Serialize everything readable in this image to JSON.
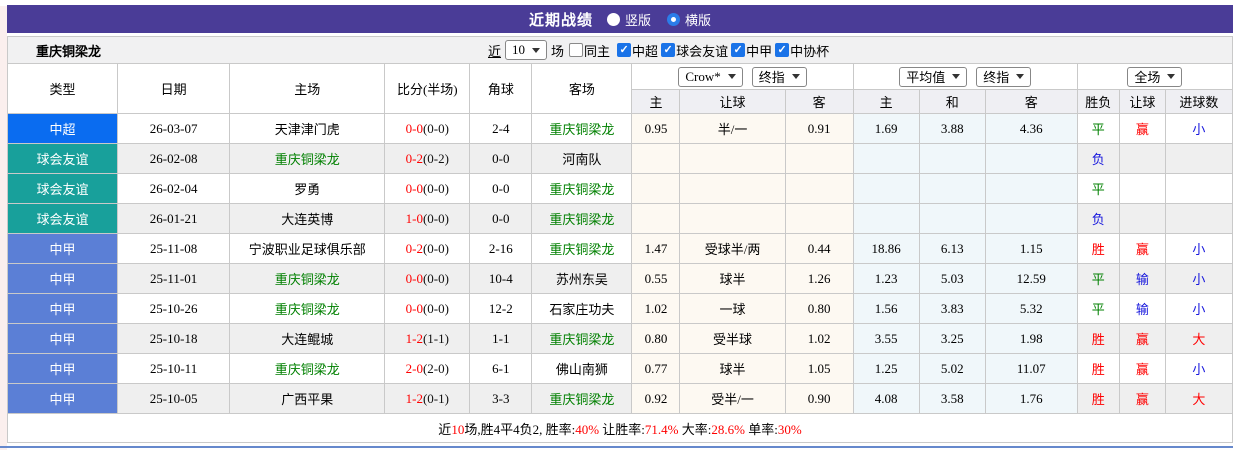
{
  "header": {
    "title": "近期战绩",
    "view_options": [
      {
        "label": "竖版",
        "selected": false
      },
      {
        "label": "横版",
        "selected": true
      }
    ]
  },
  "toolbar": {
    "team_name": "重庆铜梁龙",
    "recent_label": "近",
    "recent_count": "10",
    "matches_label": "场",
    "same_home": {
      "label": "同主",
      "checked": false
    },
    "league_filters": [
      {
        "label": "中超",
        "checked": true
      },
      {
        "label": "球会友谊",
        "checked": true
      },
      {
        "label": "中甲",
        "checked": true
      },
      {
        "label": "中协杯",
        "checked": true
      }
    ]
  },
  "table": {
    "columns_left": [
      "类型",
      "日期",
      "主场",
      "比分(半场)",
      "角球",
      "客场"
    ],
    "odds_group1_dropdowns": [
      "Crow*",
      "终指"
    ],
    "odds_group2_dropdowns": [
      "平均值",
      "终指"
    ],
    "odds_group3_dropdown": "全场",
    "columns_odds": [
      "主",
      "让球",
      "客",
      "主",
      "和",
      "客",
      "胜负",
      "让球",
      "进球数"
    ],
    "type_colors": {
      "中超": "#0a6cf0",
      "球会友谊": "#18a09b",
      "中甲": "#5b7fd6"
    },
    "rows": [
      {
        "type": "中超",
        "date": "26-03-07",
        "home": {
          "name": "天津津门虎",
          "highlight": false
        },
        "score_ft": "0-0",
        "score_ht": "(0-0)",
        "corner": "2-4",
        "away": {
          "name": "重庆铜梁龙",
          "highlight": true
        },
        "crow": [
          "0.95",
          "半/一",
          "0.91"
        ],
        "avg": [
          "1.69",
          "3.88",
          "4.36"
        ],
        "results": [
          {
            "text": "平",
            "color": "green"
          },
          {
            "text": "赢",
            "color": "red"
          },
          {
            "text": "小",
            "color": "blue"
          }
        ]
      },
      {
        "type": "球会友谊",
        "date": "26-02-08",
        "home": {
          "name": "重庆铜梁龙",
          "highlight": true
        },
        "score_ft": "0-2",
        "score_ht": "(0-2)",
        "corner": "0-0",
        "away": {
          "name": "河南队",
          "highlight": false
        },
        "crow": [
          "",
          "",
          ""
        ],
        "avg": [
          "",
          "",
          ""
        ],
        "results": [
          {
            "text": "负",
            "color": "blue"
          },
          {
            "text": "",
            "color": ""
          },
          {
            "text": "",
            "color": ""
          }
        ]
      },
      {
        "type": "球会友谊",
        "date": "26-02-04",
        "home": {
          "name": "罗勇",
          "highlight": false
        },
        "score_ft": "0-0",
        "score_ht": "(0-0)",
        "corner": "0-0",
        "away": {
          "name": "重庆铜梁龙",
          "highlight": true
        },
        "crow": [
          "",
          "",
          ""
        ],
        "avg": [
          "",
          "",
          ""
        ],
        "results": [
          {
            "text": "平",
            "color": "green"
          },
          {
            "text": "",
            "color": ""
          },
          {
            "text": "",
            "color": ""
          }
        ]
      },
      {
        "type": "球会友谊",
        "date": "26-01-21",
        "home": {
          "name": "大连英博",
          "highlight": false
        },
        "score_ft": "1-0",
        "score_ht": "(0-0)",
        "corner": "0-0",
        "away": {
          "name": "重庆铜梁龙",
          "highlight": true
        },
        "crow": [
          "",
          "",
          ""
        ],
        "avg": [
          "",
          "",
          ""
        ],
        "results": [
          {
            "text": "负",
            "color": "blue"
          },
          {
            "text": "",
            "color": ""
          },
          {
            "text": "",
            "color": ""
          }
        ]
      },
      {
        "type": "中甲",
        "date": "25-11-08",
        "home": {
          "name": "宁波职业足球俱乐部",
          "highlight": false
        },
        "score_ft": "0-2",
        "score_ht": "(0-0)",
        "corner": "2-16",
        "away": {
          "name": "重庆铜梁龙",
          "highlight": true
        },
        "crow": [
          "1.47",
          "受球半/两",
          "0.44"
        ],
        "avg": [
          "18.86",
          "6.13",
          "1.15"
        ],
        "results": [
          {
            "text": "胜",
            "color": "red"
          },
          {
            "text": "赢",
            "color": "red"
          },
          {
            "text": "小",
            "color": "blue"
          }
        ]
      },
      {
        "type": "中甲",
        "date": "25-11-01",
        "home": {
          "name": "重庆铜梁龙",
          "highlight": true
        },
        "score_ft": "0-0",
        "score_ht": "(0-0)",
        "corner": "10-4",
        "away": {
          "name": "苏州东吴",
          "highlight": false
        },
        "crow": [
          "0.55",
          "球半",
          "1.26"
        ],
        "avg": [
          "1.23",
          "5.03",
          "12.59"
        ],
        "results": [
          {
            "text": "平",
            "color": "green"
          },
          {
            "text": "输",
            "color": "blue"
          },
          {
            "text": "小",
            "color": "blue"
          }
        ]
      },
      {
        "type": "中甲",
        "date": "25-10-26",
        "home": {
          "name": "重庆铜梁龙",
          "highlight": true
        },
        "score_ft": "0-0",
        "score_ht": "(0-0)",
        "corner": "12-2",
        "away": {
          "name": "石家庄功夫",
          "highlight": false
        },
        "crow": [
          "1.02",
          "一球",
          "0.80"
        ],
        "avg": [
          "1.56",
          "3.83",
          "5.32"
        ],
        "results": [
          {
            "text": "平",
            "color": "green"
          },
          {
            "text": "输",
            "color": "blue"
          },
          {
            "text": "小",
            "color": "blue"
          }
        ]
      },
      {
        "type": "中甲",
        "date": "25-10-18",
        "home": {
          "name": "大连鲲城",
          "highlight": false
        },
        "score_ft": "1-2",
        "score_ht": "(1-1)",
        "corner": "1-1",
        "away": {
          "name": "重庆铜梁龙",
          "highlight": true
        },
        "crow": [
          "0.80",
          "受半球",
          "1.02"
        ],
        "avg": [
          "3.55",
          "3.25",
          "1.98"
        ],
        "results": [
          {
            "text": "胜",
            "color": "red"
          },
          {
            "text": "赢",
            "color": "red"
          },
          {
            "text": "大",
            "color": "red"
          }
        ]
      },
      {
        "type": "中甲",
        "date": "25-10-11",
        "home": {
          "name": "重庆铜梁龙",
          "highlight": true
        },
        "score_ft": "2-0",
        "score_ht": "(2-0)",
        "corner": "6-1",
        "away": {
          "name": "佛山南狮",
          "highlight": false
        },
        "crow": [
          "0.77",
          "球半",
          "1.05"
        ],
        "avg": [
          "1.25",
          "5.02",
          "11.07"
        ],
        "results": [
          {
            "text": "胜",
            "color": "red"
          },
          {
            "text": "赢",
            "color": "red"
          },
          {
            "text": "小",
            "color": "blue"
          }
        ]
      },
      {
        "type": "中甲",
        "date": "25-10-05",
        "home": {
          "name": "广西平果",
          "highlight": false
        },
        "score_ft": "1-2",
        "score_ht": "(0-1)",
        "corner": "3-3",
        "away": {
          "name": "重庆铜梁龙",
          "highlight": true
        },
        "crow": [
          "0.92",
          "受半/一",
          "0.90"
        ],
        "avg": [
          "4.08",
          "3.58",
          "1.76"
        ],
        "results": [
          {
            "text": "胜",
            "color": "red"
          },
          {
            "text": "赢",
            "color": "red"
          },
          {
            "text": "大",
            "color": "red"
          }
        ]
      }
    ]
  },
  "footer": {
    "segments": [
      {
        "text": "近",
        "red": false
      },
      {
        "text": "10",
        "red": true
      },
      {
        "text": "场,胜4平4负2, 胜率:",
        "red": false
      },
      {
        "text": "40%",
        "red": true
      },
      {
        "text": " 让胜率:",
        "red": false
      },
      {
        "text": "71.4%",
        "red": true
      },
      {
        "text": " 大率:",
        "red": false
      },
      {
        "text": "28.6%",
        "red": true
      },
      {
        "text": " 单率:",
        "red": false
      },
      {
        "text": "30%",
        "red": true
      }
    ]
  }
}
